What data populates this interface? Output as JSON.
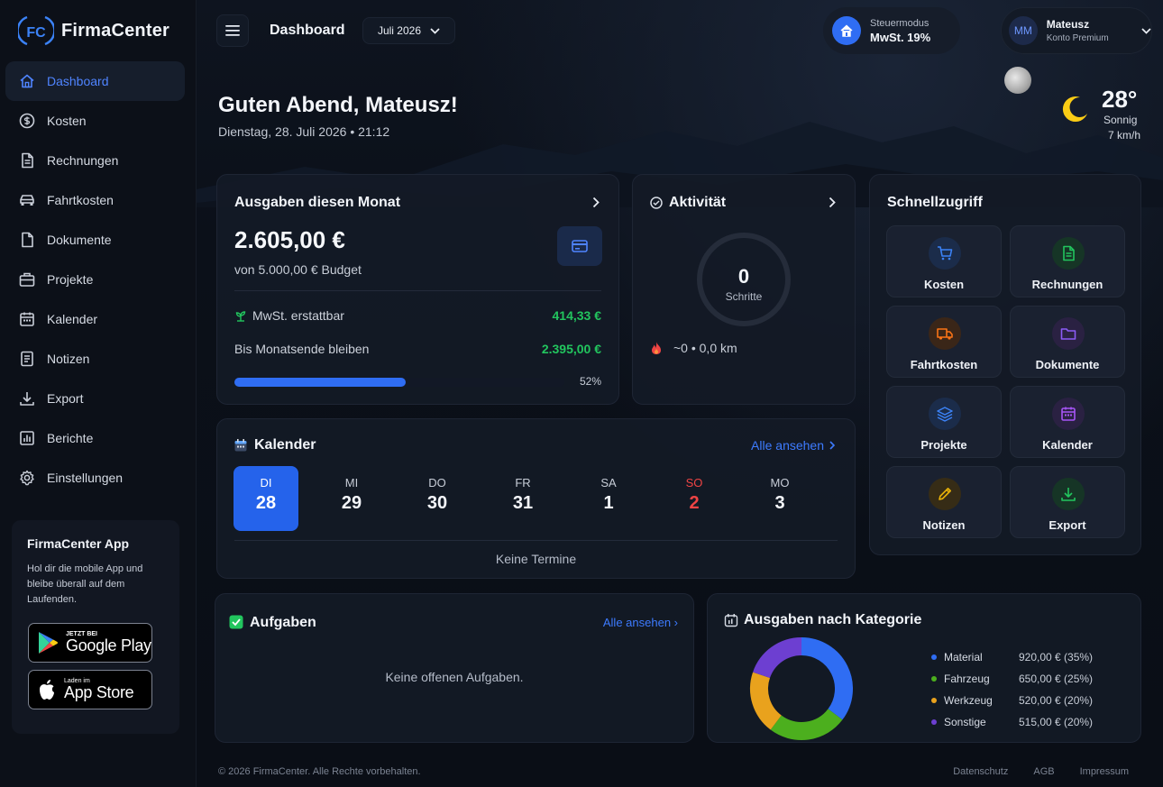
{
  "brand": {
    "logo_text": "FC",
    "name": "FirmaCenter"
  },
  "sidebar": {
    "items": [
      {
        "label": "Dashboard",
        "icon": "home-icon",
        "active": true
      },
      {
        "label": "Kosten",
        "icon": "coin-icon"
      },
      {
        "label": "Rechnungen",
        "icon": "document-icon"
      },
      {
        "label": "Fahrtkosten",
        "icon": "car-icon"
      },
      {
        "label": "Dokumente",
        "icon": "file-icon"
      },
      {
        "label": "Projekte",
        "icon": "briefcase-icon"
      },
      {
        "label": "Kalender",
        "icon": "calendar-icon"
      },
      {
        "label": "Notizen",
        "icon": "note-icon"
      },
      {
        "label": "Export",
        "icon": "download-icon"
      },
      {
        "label": "Berichte",
        "icon": "chart-icon"
      },
      {
        "label": "Einstellungen",
        "icon": "gear-icon"
      }
    ],
    "promo": {
      "title": "FirmaCenter App",
      "text": "Hol dir die mobile App und bleibe überall auf dem Laufenden.",
      "google_small": "JETZT BEI",
      "google_big": "Google Play",
      "apple_small": "Laden im",
      "apple_big": "App Store"
    }
  },
  "header": {
    "title": "Dashboard",
    "month": "Juli 2026",
    "tax_label": "Steuermodus",
    "tax_value": "MwSt. 19%",
    "user_initials": "MM",
    "user_name": "Mateusz",
    "user_plan": "Konto Premium"
  },
  "greeting": {
    "title": "Guten Abend, Mateusz!",
    "date": "Dienstag, 28. Juli 2026 • 21:12"
  },
  "weather": {
    "temp": "28°",
    "desc": "Sonnig",
    "wind": "7 km/h"
  },
  "expenses": {
    "title": "Ausgaben diesen Monat",
    "amount": "2.605,00 €",
    "budget": "von 5.000,00 € Budget",
    "vat_label": "MwSt. erstattbar",
    "vat_value": "414,33 €",
    "remaining_label": "Bis Monatsende bleiben",
    "remaining_value": "2.395,00 €",
    "progress": 52,
    "progress_label": "52%"
  },
  "activity": {
    "title": "Aktivität",
    "steps": "0",
    "steps_label": "Schritte",
    "meta": "~0 • 0,0 km"
  },
  "quick": {
    "title": "Schnellzugriff",
    "tiles": [
      {
        "label": "Kosten",
        "icon": "cart-icon",
        "color": "#3b82f6",
        "bg": "#1b2c4a"
      },
      {
        "label": "Rechnungen",
        "icon": "invoice-icon",
        "color": "#22c55e",
        "bg": "#163526"
      },
      {
        "label": "Fahrtkosten",
        "icon": "truck-icon",
        "color": "#f97316",
        "bg": "#3a2618"
      },
      {
        "label": "Dokumente",
        "icon": "folder-icon",
        "color": "#8b5cf6",
        "bg": "#2a2142"
      },
      {
        "label": "Projekte",
        "icon": "layers-icon",
        "color": "#3b82f6",
        "bg": "#1b2c4a"
      },
      {
        "label": "Kalender",
        "icon": "calendar-icon",
        "color": "#a855f7",
        "bg": "#2a2142"
      },
      {
        "label": "Notizen",
        "icon": "pencil-icon",
        "color": "#eab308",
        "bg": "#362c16"
      },
      {
        "label": "Export",
        "icon": "download-icon",
        "color": "#22c55e",
        "bg": "#163526"
      }
    ]
  },
  "calendar": {
    "title": "Kalender",
    "link": "Alle ansehen",
    "days": [
      {
        "name": "DI",
        "date": "28",
        "active": true
      },
      {
        "name": "MI",
        "date": "29"
      },
      {
        "name": "DO",
        "date": "30"
      },
      {
        "name": "FR",
        "date": "31"
      },
      {
        "name": "SA",
        "date": "1"
      },
      {
        "name": "SO",
        "date": "2",
        "sunday": true
      },
      {
        "name": "MO",
        "date": "3"
      }
    ],
    "empty": "Keine Termine"
  },
  "tasks": {
    "title": "Aufgaben",
    "link": "Alle ansehen ›",
    "empty": "Keine offenen Aufgaben."
  },
  "chart_data": {
    "type": "pie",
    "title": "Ausgaben nach Kategorie",
    "categories": [
      "Material",
      "Fahrzeug",
      "Werkzeug",
      "Sonstige"
    ],
    "values": [
      920,
      650,
      520,
      515
    ],
    "labels": [
      "920,00 € (35%)",
      "650,00 € (25%)",
      "520,00 € (20%)",
      "515,00 € (20%)"
    ],
    "colors": [
      "#2f6df3",
      "#4caf1e",
      "#e9a21d",
      "#6d3fd1"
    ],
    "legend": "right"
  },
  "footer": {
    "copyright": "© 2026 FirmaCenter. Alle Rechte vorbehalten.",
    "links": [
      "Datenschutz",
      "AGB",
      "Impressum"
    ]
  }
}
